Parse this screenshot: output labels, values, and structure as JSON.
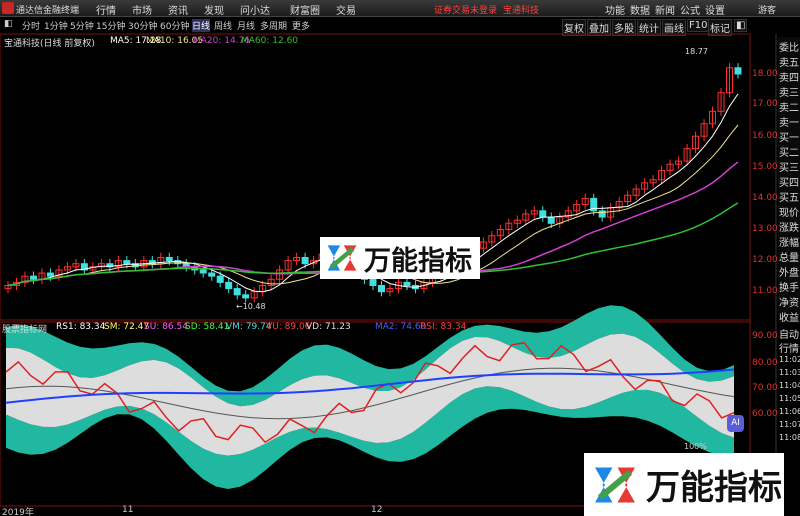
{
  "app": {
    "title": "通达信金融终端"
  },
  "menus": [
    "行情",
    "市场",
    "资讯",
    "发现",
    "问小达",
    "财富圈",
    "交易"
  ],
  "notice": {
    "text": "证券交易未登录",
    "stock": "宝通科技"
  },
  "right_menus": [
    "功能",
    "数据",
    "新闻",
    "公式",
    "设置"
  ],
  "guest": "游客",
  "period_tabs": [
    "分时",
    "1分钟",
    "5分钟",
    "15分钟",
    "30分钟",
    "60分钟",
    "日线",
    "周线",
    "月线",
    "多周期",
    "更多"
  ],
  "active_period": "日线",
  "toolbar_right": [
    "复权",
    "叠加",
    "多股",
    "统计",
    "画线",
    "F10",
    "标记",
    "◧"
  ],
  "main_info": {
    "stock": "宝通科技(日线 前复权)",
    "ma5": "MA5: 17.28",
    "ma10": "MA10: 16.05",
    "ma20": "MA20: 14.76",
    "ma60": "MA60: 12.60"
  },
  "sub_info": {
    "name": "股票指标网",
    "rs1": "RS1: 83.34",
    "sm": "SM: 72.47",
    "su": "SU: 86.54",
    "sd": "SD: 58.41",
    "vm": "VM: 79.74",
    "vu": "VU: 89.06",
    "vd": "VD: 71.23",
    "ma2": "MA2: 74.60",
    "rsi": "RSI: 83.34"
  },
  "price_labels": [
    "18.00",
    "17.00",
    "16.00",
    "15.00",
    "14.00",
    "13.00",
    "12.00",
    "11.00"
  ],
  "sub_labels": [
    "90.00",
    "80.00",
    "70.00",
    "60.00"
  ],
  "markers": {
    "high": "18.77",
    "low": "10.48"
  },
  "side_panel": [
    "委比",
    "卖五",
    "卖四",
    "卖三",
    "卖二",
    "卖一",
    "买一",
    "买二",
    "买三",
    "买四",
    "买五",
    "现价",
    "涨跌",
    "涨幅",
    "总量",
    "外盘",
    "换手",
    "净资",
    "收益"
  ],
  "side_panel2": [
    "自动",
    "行情",
    "11:02",
    "11:03",
    "11:04",
    "11:05",
    "11:06",
    "11:07",
    "11:08"
  ],
  "x_axis": [
    "2019年",
    "11",
    "12"
  ],
  "watermark": "万能指标",
  "ai_label": "AI",
  "zoom_label": "100%",
  "colors": {
    "ma5": "#ffffff",
    "ma10": "#f0e68c",
    "ma20": "#d040d0",
    "ma60": "#30c030",
    "up": "#ff3030",
    "down": "#40e0e0",
    "band": "#20b8a0",
    "band_light": "#dddddd",
    "red_line": "#e02020",
    "blue_line": "#2040ff"
  }
}
